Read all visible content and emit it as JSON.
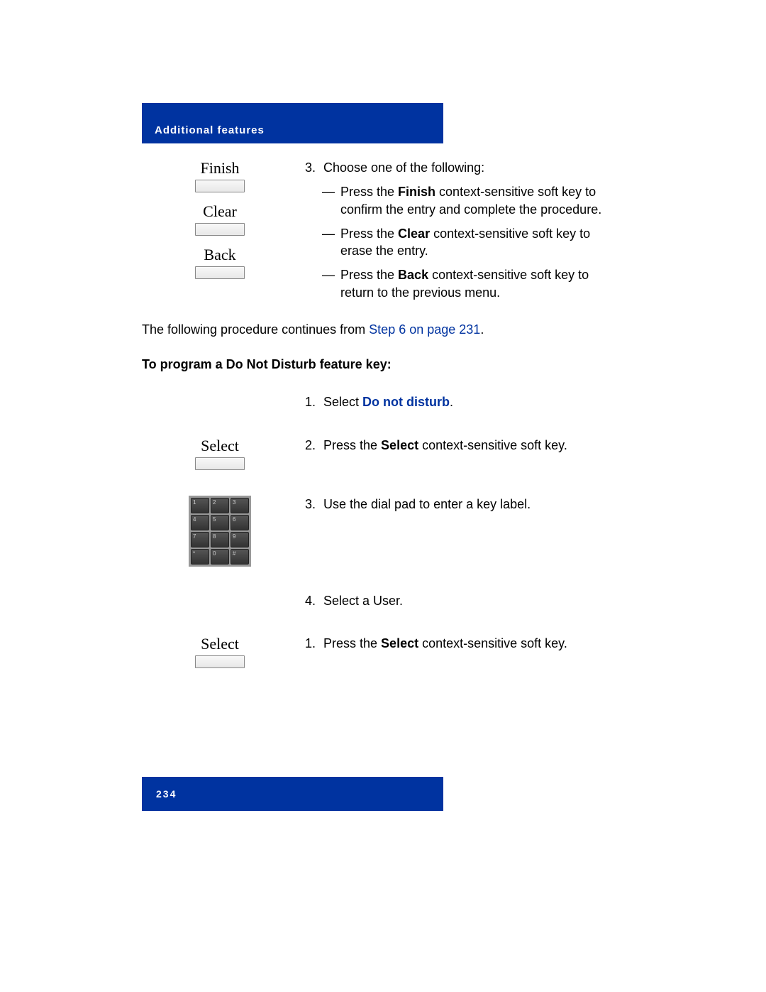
{
  "header": {
    "title": "Additional features"
  },
  "softkeys": {
    "finish": "Finish",
    "clear": "Clear",
    "back": "Back",
    "select": "Select"
  },
  "step3": {
    "num": "3.",
    "intro": "Choose one of the following:",
    "dash": "—",
    "opt1_a": "Press the ",
    "opt1_b": "Finish",
    "opt1_c": " context-sensitive soft key to confirm the entry and complete the procedure.",
    "opt2_a": "Press the ",
    "opt2_b": "Clear",
    "opt2_c": " context-sensitive soft key to erase the entry.",
    "opt3_a": "Press the ",
    "opt3_b": "Back",
    "opt3_c": " context-sensitive soft key to return to the previous menu."
  },
  "continue": {
    "a": "The following procedure continues from  ",
    "link": "Step 6 on page 231",
    "b": "."
  },
  "section_heading": "To program a Do Not Disturb feature key:",
  "dnd": {
    "s1_num": "1.",
    "s1_a": "Select ",
    "s1_b": "Do not disturb",
    "s1_c": ".",
    "s2_num": "2.",
    "s2_a": "Press the ",
    "s2_b": "Select",
    "s2_c": " context-sensitive soft key.",
    "s3_num": "3.",
    "s3": "Use the dial pad to enter a key label.",
    "s4_num": "4.",
    "s4": "Select a User.",
    "s5_num": "1.",
    "s5_a": "Press the ",
    "s5_b": "Select",
    "s5_c": " context-sensitive soft key."
  },
  "dialpad": [
    "1",
    "2",
    "3",
    "4",
    "5",
    "6",
    "7",
    "8",
    "9",
    "*",
    "0",
    "#"
  ],
  "footer": {
    "page_number": "234"
  }
}
